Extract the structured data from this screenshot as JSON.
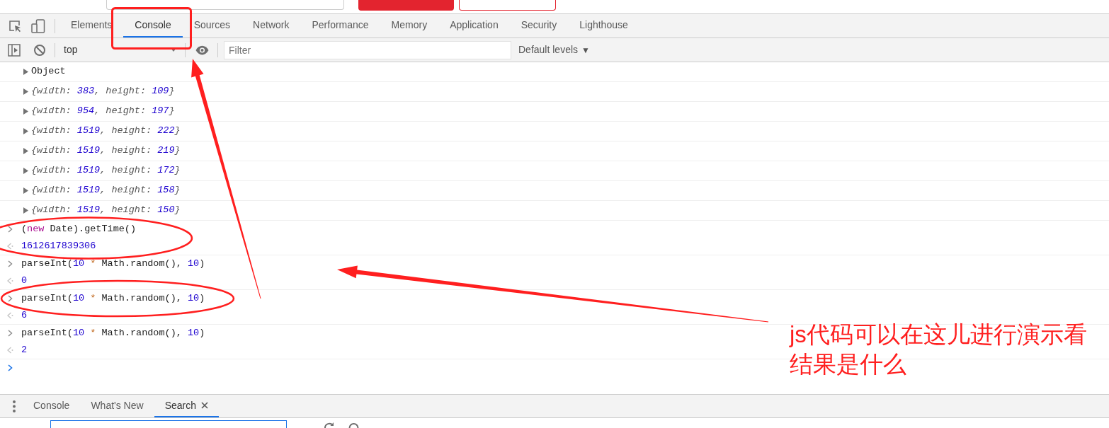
{
  "page": {
    "controls": [
      {
        "kind": "field"
      },
      {
        "kind": "filled"
      },
      {
        "kind": "outlined"
      }
    ]
  },
  "devtools_tabs": [
    {
      "label": "Elements",
      "selected": false
    },
    {
      "label": "Console",
      "selected": true
    },
    {
      "label": "Sources",
      "selected": false
    },
    {
      "label": "Network",
      "selected": false
    },
    {
      "label": "Performance",
      "selected": false
    },
    {
      "label": "Memory",
      "selected": false
    },
    {
      "label": "Application",
      "selected": false
    },
    {
      "label": "Security",
      "selected": false
    },
    {
      "label": "Lighthouse",
      "selected": false
    }
  ],
  "console_toolbar": {
    "context": "top",
    "filter": {
      "placeholder": "Filter"
    },
    "levels": {
      "label": "Default levels",
      "caret": "▼"
    }
  },
  "console": {
    "messages": [
      {
        "kind": "object",
        "tokens": [
          {
            "kind": "plain",
            "text": "Object"
          }
        ]
      },
      {
        "kind": "preview",
        "tokens": [
          {
            "kind": "key",
            "text": "{width: "
          },
          {
            "kind": "number",
            "text": "383"
          },
          {
            "kind": "key",
            "text": ", height: "
          },
          {
            "kind": "number",
            "text": "109"
          },
          {
            "kind": "key",
            "text": "}"
          }
        ]
      },
      {
        "kind": "preview",
        "tokens": [
          {
            "kind": "key",
            "text": "{width: "
          },
          {
            "kind": "number",
            "text": "954"
          },
          {
            "kind": "key",
            "text": ", height: "
          },
          {
            "kind": "number",
            "text": "197"
          },
          {
            "kind": "key",
            "text": "}"
          }
        ]
      },
      {
        "kind": "preview",
        "tokens": [
          {
            "kind": "key",
            "text": "{width: "
          },
          {
            "kind": "number",
            "text": "1519"
          },
          {
            "kind": "key",
            "text": ", height: "
          },
          {
            "kind": "number",
            "text": "222"
          },
          {
            "kind": "key",
            "text": "}"
          }
        ]
      },
      {
        "kind": "preview",
        "tokens": [
          {
            "kind": "key",
            "text": "{width: "
          },
          {
            "kind": "number",
            "text": "1519"
          },
          {
            "kind": "key",
            "text": ", height: "
          },
          {
            "kind": "number",
            "text": "219"
          },
          {
            "kind": "key",
            "text": "}"
          }
        ]
      },
      {
        "kind": "preview",
        "tokens": [
          {
            "kind": "key",
            "text": "{width: "
          },
          {
            "kind": "number",
            "text": "1519"
          },
          {
            "kind": "key",
            "text": ", height: "
          },
          {
            "kind": "number",
            "text": "172"
          },
          {
            "kind": "key",
            "text": "}"
          }
        ]
      },
      {
        "kind": "preview",
        "tokens": [
          {
            "kind": "key",
            "text": "{width: "
          },
          {
            "kind": "number",
            "text": "1519"
          },
          {
            "kind": "key",
            "text": ", height: "
          },
          {
            "kind": "number",
            "text": "158"
          },
          {
            "kind": "key",
            "text": "}"
          }
        ]
      },
      {
        "kind": "preview",
        "tokens": [
          {
            "kind": "key",
            "text": "{width: "
          },
          {
            "kind": "number",
            "text": "1519"
          },
          {
            "kind": "key",
            "text": ", height: "
          },
          {
            "kind": "number",
            "text": "150"
          },
          {
            "kind": "key",
            "text": "}"
          }
        ]
      },
      {
        "kind": "evaluation",
        "command": [
          {
            "kind": "plain",
            "text": "("
          },
          {
            "kind": "keyword",
            "text": "new"
          },
          {
            "kind": "plain",
            "text": " Date).getTime()"
          }
        ],
        "result": [
          {
            "kind": "number",
            "text": "1612617839306"
          }
        ]
      },
      {
        "kind": "evaluation",
        "command": [
          {
            "kind": "plain",
            "text": "parseInt("
          },
          {
            "kind": "number",
            "text": "10"
          },
          {
            "kind": "operator",
            "text": " * "
          },
          {
            "kind": "plain",
            "text": "Math.random(), "
          },
          {
            "kind": "number",
            "text": "10"
          },
          {
            "kind": "plain",
            "text": ")"
          }
        ],
        "result": [
          {
            "kind": "number",
            "text": "0"
          }
        ]
      },
      {
        "kind": "evaluation",
        "command": [
          {
            "kind": "plain",
            "text": "parseInt("
          },
          {
            "kind": "number",
            "text": "10"
          },
          {
            "kind": "operator",
            "text": " * "
          },
          {
            "kind": "plain",
            "text": "Math.random(), "
          },
          {
            "kind": "number",
            "text": "10"
          },
          {
            "kind": "plain",
            "text": ")"
          }
        ],
        "result": [
          {
            "kind": "number",
            "text": "6"
          }
        ]
      },
      {
        "kind": "evaluation",
        "command": [
          {
            "kind": "plain",
            "text": "parseInt("
          },
          {
            "kind": "number",
            "text": "10"
          },
          {
            "kind": "operator",
            "text": " * "
          },
          {
            "kind": "plain",
            "text": "Math.random(), "
          },
          {
            "kind": "number",
            "text": "10"
          },
          {
            "kind": "plain",
            "text": ")"
          }
        ],
        "result": [
          {
            "kind": "number",
            "text": "2"
          }
        ]
      },
      {
        "kind": "prompt"
      }
    ]
  },
  "drawer": {
    "tabs": [
      {
        "label": "Console",
        "selected": false,
        "closable": false
      },
      {
        "label": "What's New",
        "selected": false,
        "closable": false
      },
      {
        "label": "Search",
        "selected": true,
        "closable": true
      }
    ]
  },
  "annotation": {
    "note": "js代码可以在这儿进行演示看结果是什么"
  }
}
